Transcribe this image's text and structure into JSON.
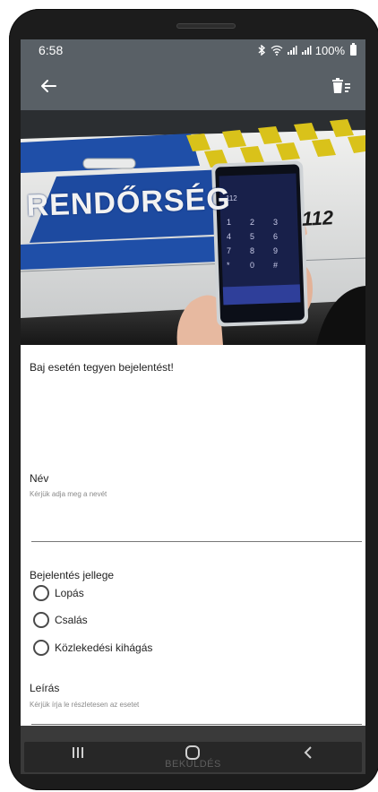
{
  "statusbar": {
    "time": "6:58",
    "battery_percent": "100%",
    "icons": [
      "bluetooth-icon",
      "wifi-icon",
      "signal-icon",
      "signal-icon",
      "battery-icon"
    ]
  },
  "toolbar": {
    "back_icon": "arrow-left-icon",
    "action_icon": "delete-list-icon"
  },
  "hero": {
    "car_text": "RENDŐRSÉG",
    "car_number": "112",
    "phone_screen_number": "112",
    "keypad": [
      "1",
      "2",
      "3",
      "4",
      "5",
      "6",
      "7",
      "8",
      "9",
      "*",
      "0",
      "#"
    ]
  },
  "form": {
    "intro": "Baj esetén tegyen bejelentést!",
    "name": {
      "label": "Név",
      "hint": "Kérjük adja meg a nevét",
      "value": ""
    },
    "report_type": {
      "label": "Bejelentés jellege",
      "options": [
        "Lopás",
        "Csalás",
        "Közlekedési kihágás"
      ],
      "selected": null
    },
    "description": {
      "label": "Leírás",
      "hint": "Kérjük írja le részletesen az esetet",
      "value": ""
    },
    "submit_label": "BEKÜLDÉS"
  },
  "navbar": {
    "keys": [
      "recent-apps-icon",
      "home-icon",
      "back-icon"
    ]
  },
  "colors": {
    "toolbar": "#596066",
    "car_blue": "#1f4fa8",
    "car_yellow": "#d9c21a",
    "submit_bar": "#272727"
  }
}
